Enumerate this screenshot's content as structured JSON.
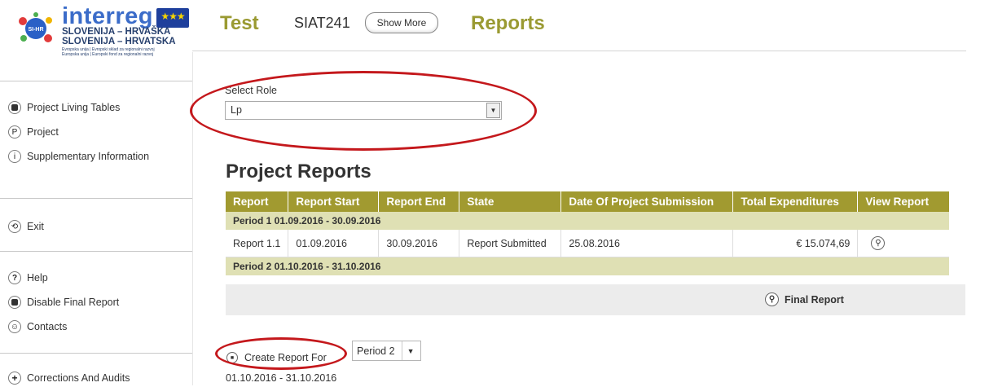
{
  "logo": {
    "wordmark": "interreg",
    "line1": "SLOVENIJA – HRVAŠKA",
    "line2": "SLOVENIJA – HRVATSKA",
    "small1": "Evropska unija | Evropski sklad za regionalni razvoj",
    "small2": "Europska unija | Europski fond za regionalni razvoj",
    "badge": "SI-HR"
  },
  "header": {
    "project_title": "Test",
    "project_code": "SIAT241",
    "show_more_label": "Show More",
    "section_title": "Reports"
  },
  "sidebar": {
    "items": [
      {
        "label": "Project Living Tables",
        "icon": "table-icon",
        "glyph": ""
      },
      {
        "label": "Project",
        "icon": "project-icon",
        "glyph": "P"
      },
      {
        "label": "Supplementary Information",
        "icon": "info-icon",
        "glyph": "i"
      },
      {
        "label": "Exit",
        "icon": "exit-icon",
        "glyph": "⟲"
      },
      {
        "label": "Help",
        "icon": "help-icon",
        "glyph": "?"
      },
      {
        "label": "Disable Final Report",
        "icon": "disable-icon",
        "glyph": ""
      },
      {
        "label": "Contacts",
        "icon": "contacts-icon",
        "glyph": "☺"
      },
      {
        "label": "Corrections And Audits",
        "icon": "plus-icon",
        "glyph": "+"
      }
    ]
  },
  "role": {
    "label": "Select Role",
    "selected": "Lp"
  },
  "reports": {
    "title": "Project Reports",
    "columns": [
      "Report",
      "Report Start",
      "Report End",
      "State",
      "Date Of Project Submission",
      "Total Expenditures",
      "View Report"
    ],
    "period1": "Period 1 01.09.2016 - 30.09.2016",
    "row1": {
      "report": "Report 1.1",
      "start": "01.09.2016",
      "end": "30.09.2016",
      "state": "Report Submitted",
      "submission": "25.08.2016",
      "total": "€ 15.074,69"
    },
    "period2": "Period 2 01.10.2016 - 31.10.2016",
    "final_report_label": "Final Report"
  },
  "create": {
    "button_label": "Create Report For",
    "period_selected": "Period 2",
    "period_dates": "01.10.2016 - 31.10.2016"
  },
  "colors": {
    "accent": "#9a9a32",
    "table_header": "#a19a30",
    "period_row": "#dfe0b4",
    "annotation": "#c4181c"
  }
}
